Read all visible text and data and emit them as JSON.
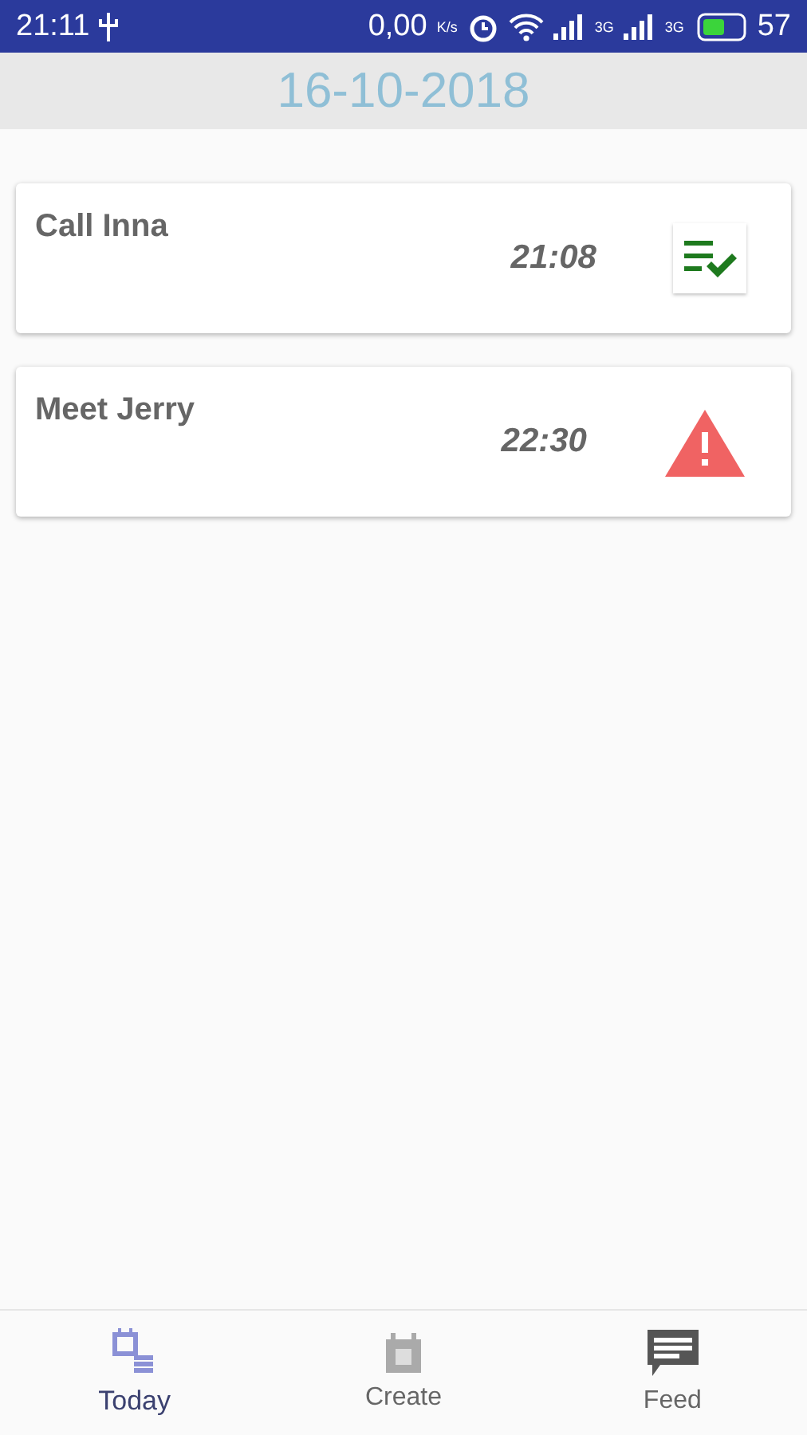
{
  "status_bar": {
    "time": "21:11",
    "speed": "0,00",
    "speed_unit": "K/s",
    "networks": [
      "3G",
      "3G"
    ],
    "battery": {
      "percent": "57"
    }
  },
  "header": {
    "date": "16-10-2018"
  },
  "tasks": [
    {
      "title": "Call Inna",
      "time": "21:08",
      "kind": "done"
    },
    {
      "title": "Meet Jerry",
      "time": "22:30",
      "kind": "warning"
    }
  ],
  "tabs": [
    {
      "label": "Today",
      "selected": true,
      "kind": "today"
    },
    {
      "label": "Create",
      "selected": false,
      "kind": "create"
    },
    {
      "label": "Feed",
      "selected": false,
      "kind": "feed"
    }
  ]
}
